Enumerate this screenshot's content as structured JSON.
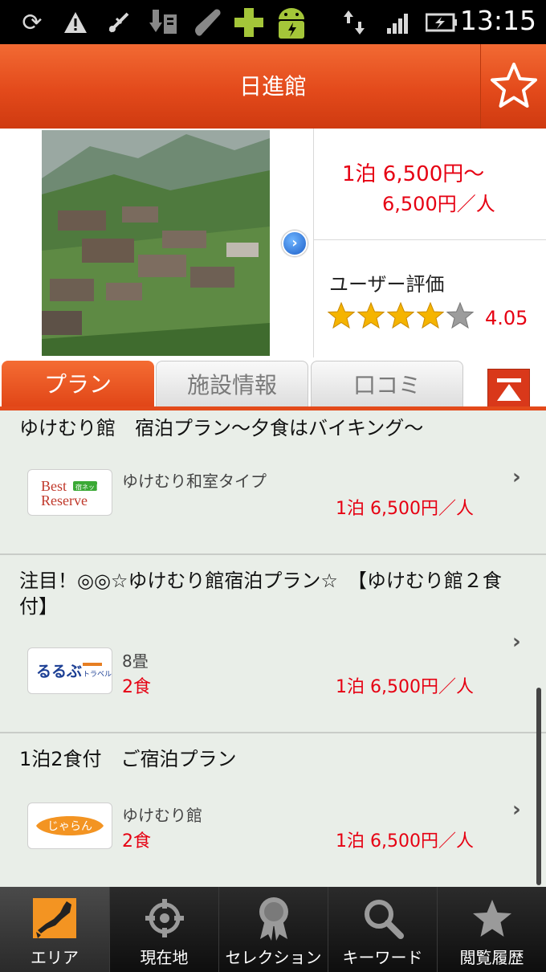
{
  "status_bar": {
    "time": "13:15",
    "icons": [
      "sync-icon",
      "warning-icon",
      "usb-icon",
      "download-icon",
      "phone-icon",
      "plus-icon",
      "android-icon",
      "data-arrows-icon",
      "signal-icon",
      "battery-icon"
    ]
  },
  "header": {
    "title": "日進館",
    "favorite_icon": "star-outline-icon"
  },
  "hotel": {
    "price_per_night": "1泊 6,500円〜",
    "price_per_person": "6,500円／人",
    "rating_label": "ユーザー評価",
    "rating_value": "4.05",
    "rating_stars_filled": 4,
    "rating_stars_total": 5
  },
  "tabs": [
    {
      "label": "プラン",
      "active": true
    },
    {
      "label": "施設情報",
      "active": false
    },
    {
      "label": "口コミ",
      "active": false
    }
  ],
  "plans": [
    {
      "title": "ゆけむり館　宿泊プラン〜夕食はバイキング〜",
      "provider_logo": "best-reserve-logo",
      "room": "ゆけむり和室タイプ",
      "meals": "",
      "price": "1泊 6,500円／人"
    },
    {
      "title": "注目！◎◎☆ゆけむり館宿泊プラン☆　【ゆけむり館２食付】",
      "provider_logo": "rurubu-travel-logo",
      "room": "8畳",
      "meals": "2食",
      "price": "1泊 6,500円／人"
    },
    {
      "title": "1泊2食付　ご宿泊プラン",
      "provider_logo": "jalan-logo",
      "room": "ゆけむり館",
      "meals": "2食",
      "price": "1泊 6,500円／人"
    }
  ],
  "logos": {
    "best_reserve_line1": "Best",
    "best_reserve_line2": "Reserve",
    "best_reserve_badge": "宿ネット",
    "rurubu_text": "るるぶ",
    "rurubu_sub": "トラベル",
    "jalan_text": "じゃらん"
  },
  "bottom_nav": [
    {
      "label": "エリア",
      "icon": "japan-map-icon",
      "active": true
    },
    {
      "label": "現在地",
      "icon": "crosshair-icon",
      "active": false
    },
    {
      "label": "セレクション",
      "icon": "award-badge-icon",
      "active": false
    },
    {
      "label": "キーワード",
      "icon": "magnifier-icon",
      "active": false
    },
    {
      "label": "閲覧履歴",
      "icon": "star-icon",
      "active": false
    }
  ],
  "colors": {
    "brand_orange": "#e34a1b",
    "price_red": "#e60012",
    "star_gold": "#f5b400"
  }
}
